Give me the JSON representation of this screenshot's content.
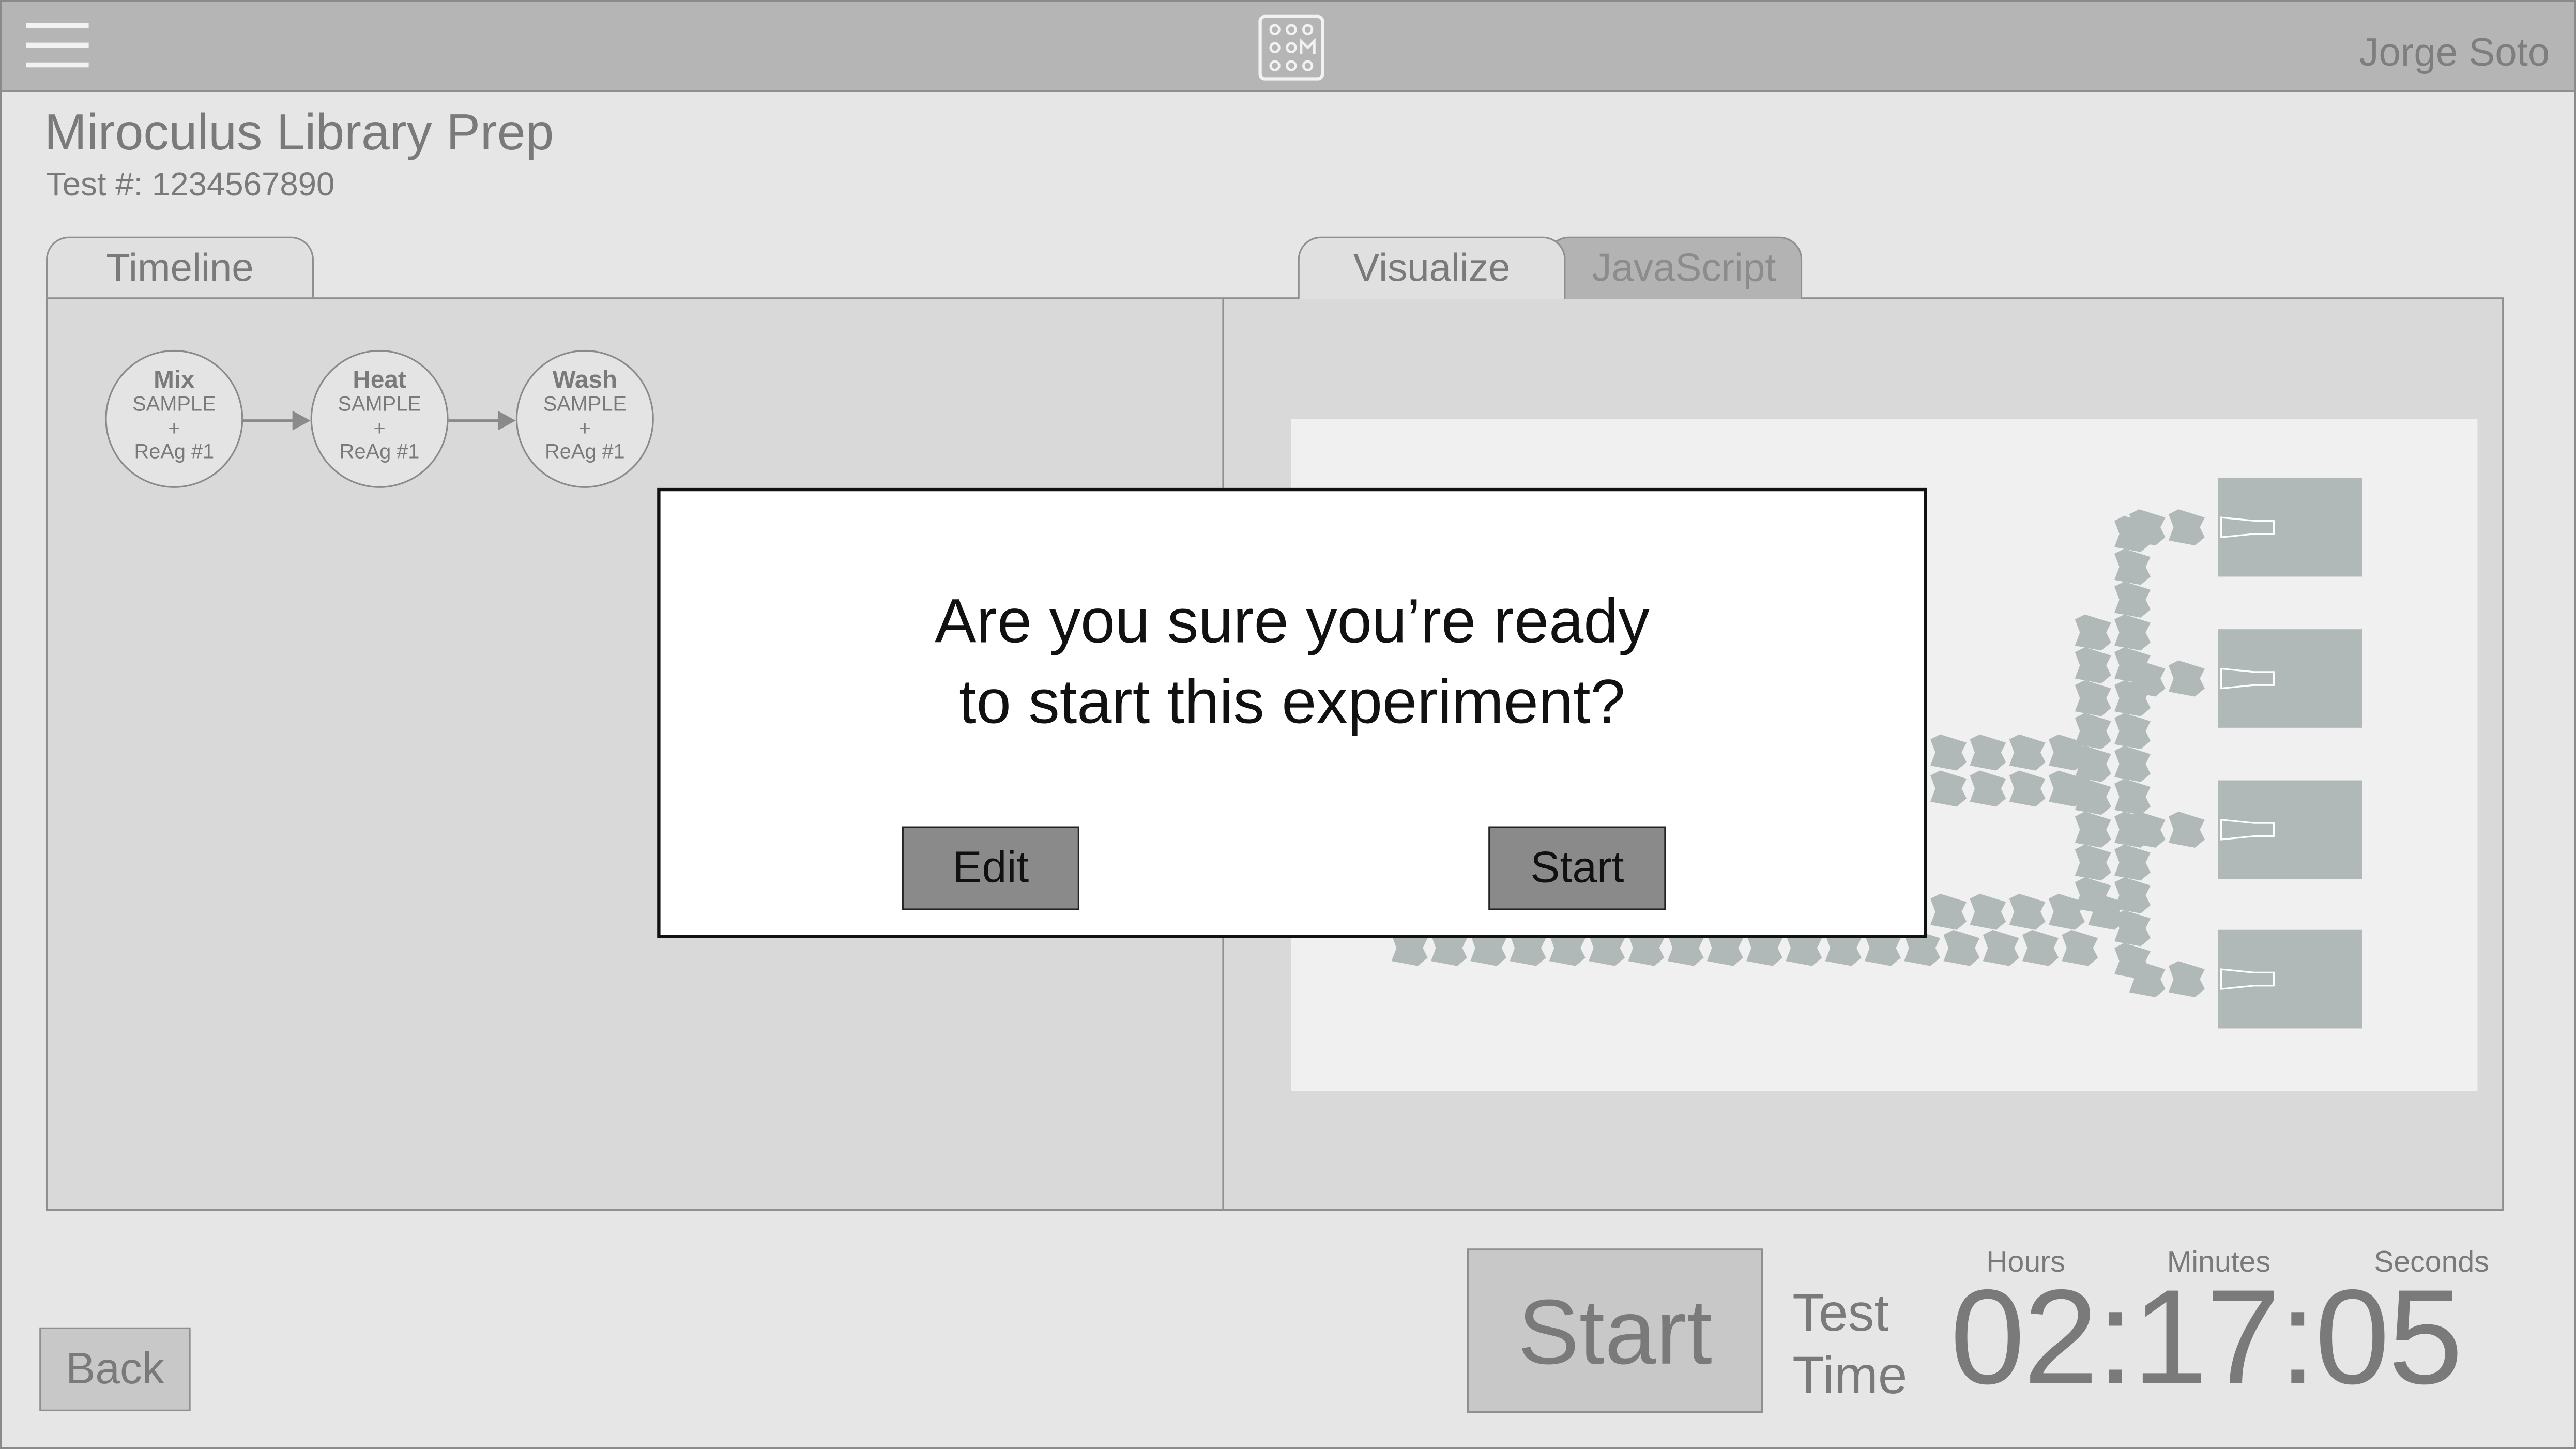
{
  "header": {
    "user_name": "Jorge Soto"
  },
  "page": {
    "title": "Miroculus Library Prep",
    "test_number": "Test #: 1234567890"
  },
  "tabs": {
    "timeline": "Timeline",
    "visualize": "Visualize",
    "javascript": "JavaScript"
  },
  "timeline": {
    "steps": [
      {
        "name": "Mix",
        "line1": "SAMPLE",
        "line2": "+",
        "line3": "ReAg #1"
      },
      {
        "name": "Heat",
        "line1": "SAMPLE",
        "line2": "+",
        "line3": "ReAg #1"
      },
      {
        "name": "Wash",
        "line1": "SAMPLE",
        "line2": "+",
        "line3": "ReAg #1"
      }
    ]
  },
  "modal": {
    "question_line1": "Are you sure you’re ready",
    "question_line2": "to start this experiment?",
    "edit_label": "Edit",
    "start_label": "Start"
  },
  "controls": {
    "back_label": "Back",
    "start_label": "Start",
    "test_time_line1": "Test",
    "test_time_line2": "Time",
    "hours_label": "Hours",
    "minutes_label": "Minutes",
    "seconds_label": "Seconds",
    "timer": "02:17:05"
  },
  "colors": {
    "topbar": "#b5b5b5",
    "background": "#e6e6e6",
    "panel": "#d9d9d9",
    "chip_electrode": "#b0b9b7",
    "modal_button": "#8a8a8a"
  }
}
